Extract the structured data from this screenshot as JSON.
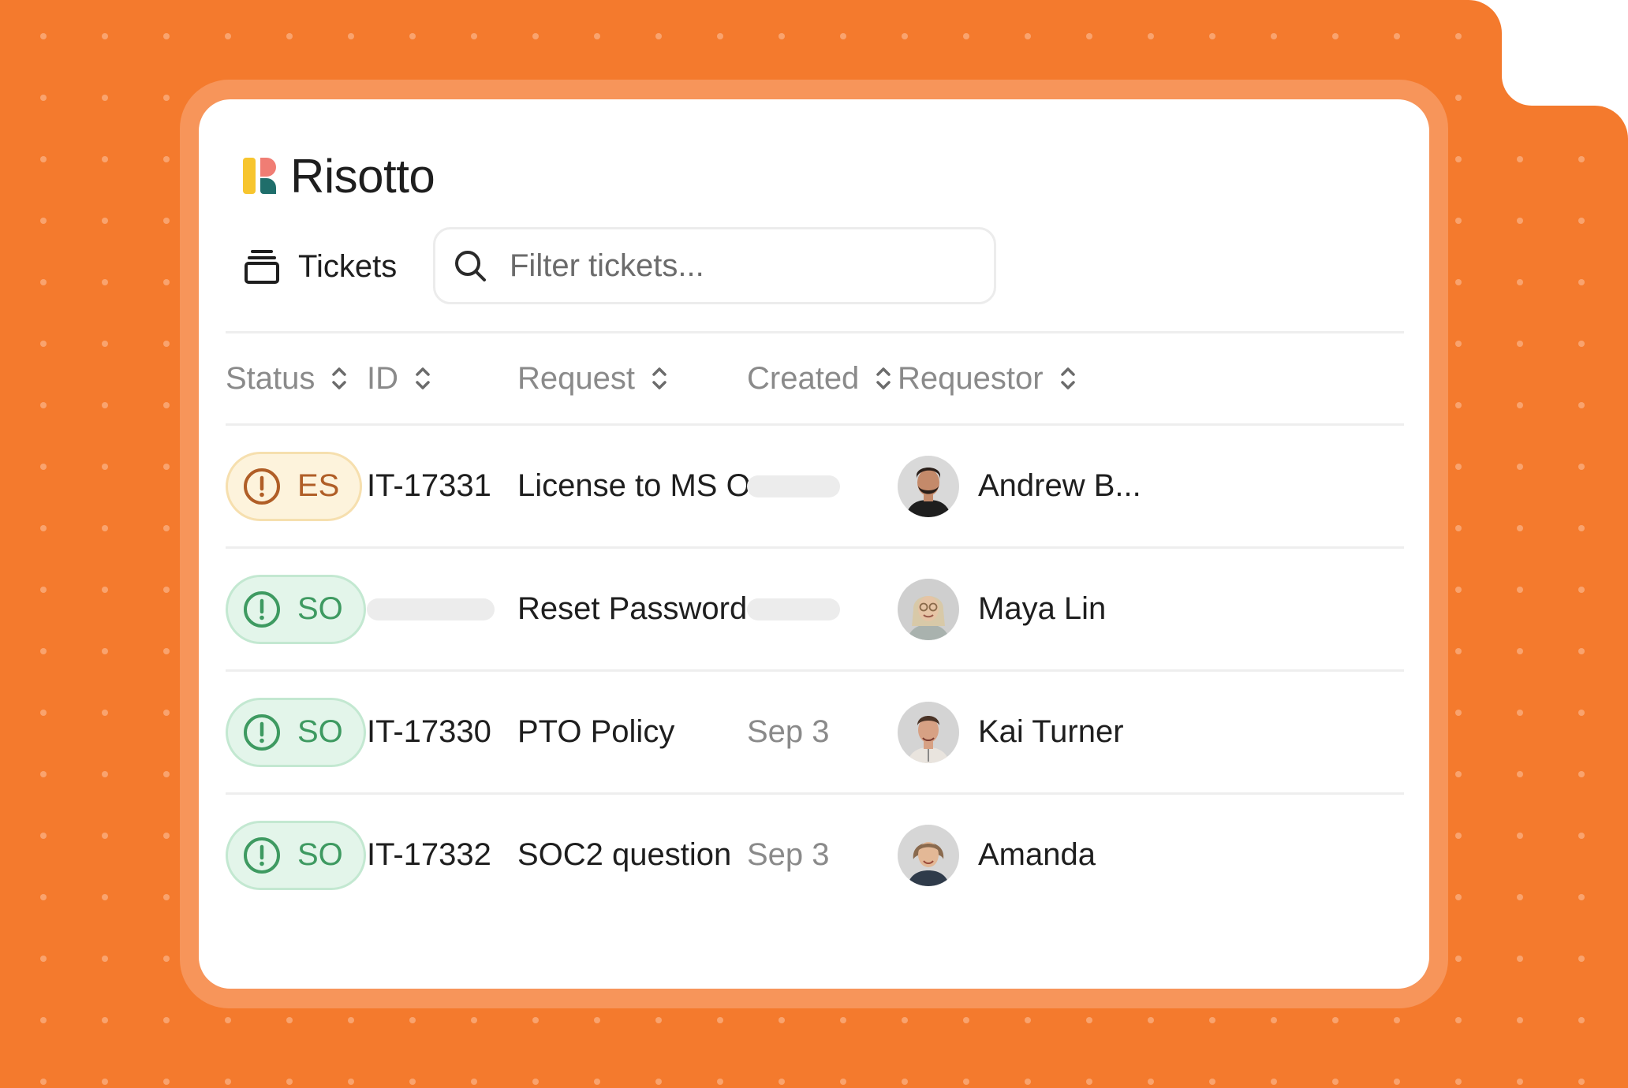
{
  "app": {
    "name": "Risotto"
  },
  "toolbar": {
    "tab_label": "Tickets",
    "search": {
      "placeholder": "Filter tickets...",
      "value": ""
    }
  },
  "table": {
    "columns": [
      "Status",
      "ID",
      "Request",
      "Created",
      "Requestor"
    ],
    "rows": [
      {
        "status": "ES",
        "status_tone": "escalated",
        "id": "IT-17331",
        "request": "License to MS O...",
        "created": null,
        "requestor": "Andrew B..."
      },
      {
        "status": "SO",
        "status_tone": "resolved",
        "id": null,
        "request": "Reset Password",
        "created": null,
        "requestor": "Maya Lin"
      },
      {
        "status": "SO",
        "status_tone": "resolved",
        "id": "IT-17330",
        "request": "PTO Policy",
        "created": "Sep 3",
        "requestor": "Kai Turner"
      },
      {
        "status": "SO",
        "status_tone": "resolved",
        "id": "IT-17332",
        "request": "SOC2 question",
        "created": "Sep 3",
        "requestor": "Amanda"
      }
    ]
  },
  "colors": {
    "brand_orange": "#F47A2D",
    "card_border": "#F7955A",
    "es_bg": "#FDF3DC",
    "es_border": "#F6DFAE",
    "es_fg": "#B05E27",
    "so_bg": "#E3F5EA",
    "so_border": "#C3E8D1",
    "so_fg": "#3E9A61"
  },
  "icons": {
    "tab": "ticket-stack-icon",
    "search": "search-icon",
    "sort": "sort-chevrons-icon",
    "status": "alert-circle-icon"
  }
}
